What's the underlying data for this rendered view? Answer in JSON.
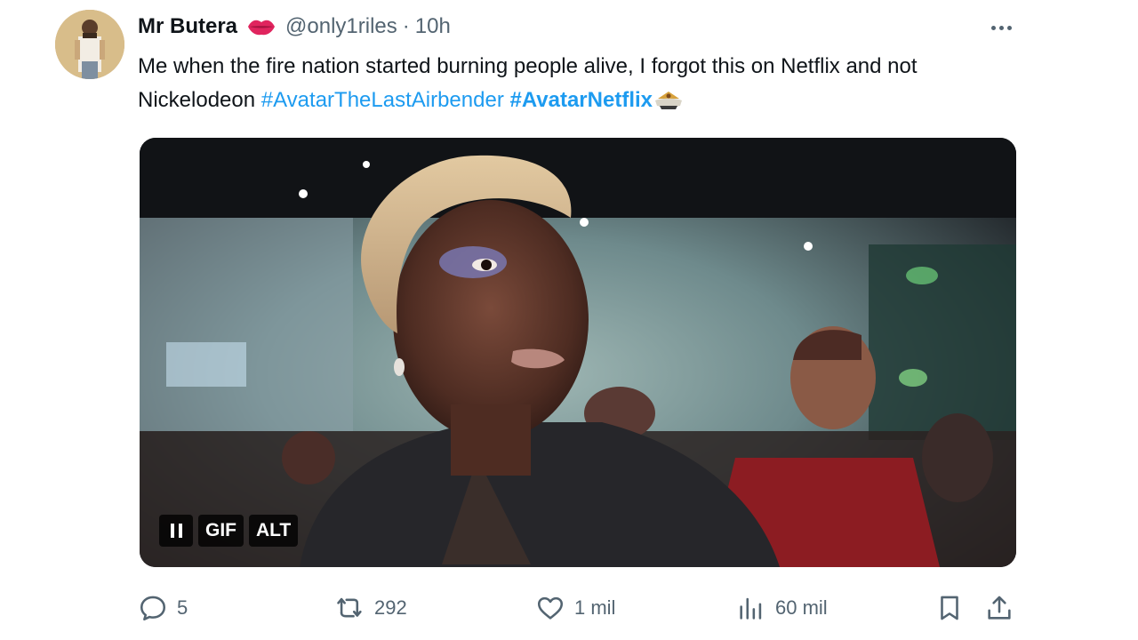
{
  "tweet": {
    "display_name": "Mr Butera",
    "handle": "@only1riles",
    "separator": "·",
    "time": "10h",
    "text_main": "Me when the fire nation started burning people alive, I forgot this on Netflix and not Nickelodeon ",
    "hashtag_1": "#AvatarTheLastAirbender",
    "hashtag_2": "#AvatarNetflix"
  },
  "media": {
    "pause_label": "pause",
    "gif_label": "GIF",
    "alt_label": "ALT"
  },
  "actions": {
    "replies": "5",
    "reposts": "292",
    "likes": "1 mil",
    "views": "60 mil"
  },
  "icons": {
    "avatar": "profile-photo",
    "badge": "lips-emoji",
    "more": "more-dots-icon",
    "hashtag_emoji": "avatar-hashflag-icon",
    "reply": "reply-icon",
    "repost": "repost-icon",
    "like": "heart-icon",
    "views": "views-icon",
    "bookmark": "bookmark-icon",
    "share": "share-icon"
  },
  "colors": {
    "link": "#1d9bf0",
    "muted": "#536471",
    "text": "#0f1419"
  }
}
